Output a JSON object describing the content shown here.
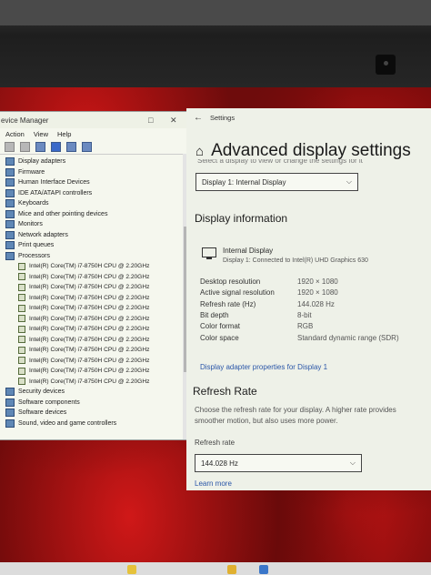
{
  "device_manager": {
    "title": "evice Manager",
    "menu": [
      "Action",
      "View",
      "Help"
    ],
    "tree": [
      {
        "label": "Display adapters",
        "type": "top"
      },
      {
        "label": "Firmware",
        "type": "top"
      },
      {
        "label": "Human Interface Devices",
        "type": "top"
      },
      {
        "label": "IDE ATA/ATAPI controllers",
        "type": "top"
      },
      {
        "label": "Keyboards",
        "type": "top"
      },
      {
        "label": "Mice and other pointing devices",
        "type": "top"
      },
      {
        "label": "Monitors",
        "type": "top"
      },
      {
        "label": "Network adapters",
        "type": "top"
      },
      {
        "label": "Print queues",
        "type": "top"
      },
      {
        "label": "Processors",
        "type": "top"
      },
      {
        "label": "Intel(R) Core(TM) i7-8750H CPU @ 2.20GHz",
        "type": "cpu"
      },
      {
        "label": "Intel(R) Core(TM) i7-8750H CPU @ 2.20GHz",
        "type": "cpu"
      },
      {
        "label": "Intel(R) Core(TM) i7-8750H CPU @ 2.20GHz",
        "type": "cpu"
      },
      {
        "label": "Intel(R) Core(TM) i7-8750H CPU @ 2.20GHz",
        "type": "cpu"
      },
      {
        "label": "Intel(R) Core(TM) i7-8750H CPU @ 2.20GHz",
        "type": "cpu"
      },
      {
        "label": "Intel(R) Core(TM) i7-8750H CPU @ 2.20GHz",
        "type": "cpu"
      },
      {
        "label": "Intel(R) Core(TM) i7-8750H CPU @ 2.20GHz",
        "type": "cpu"
      },
      {
        "label": "Intel(R) Core(TM) i7-8750H CPU @ 2.20GHz",
        "type": "cpu"
      },
      {
        "label": "Intel(R) Core(TM) i7-8750H CPU @ 2.20GHz",
        "type": "cpu"
      },
      {
        "label": "Intel(R) Core(TM) i7-8750H CPU @ 2.20GHz",
        "type": "cpu"
      },
      {
        "label": "Intel(R) Core(TM) i7-8750H CPU @ 2.20GHz",
        "type": "cpu"
      },
      {
        "label": "Intel(R) Core(TM) i7-8750H CPU @ 2.20GHz",
        "type": "cpu"
      },
      {
        "label": "Security devices",
        "type": "top"
      },
      {
        "label": "Software components",
        "type": "top"
      },
      {
        "label": "Software devices",
        "type": "top"
      },
      {
        "label": "Sound, video and game controllers",
        "type": "top"
      }
    ]
  },
  "settings": {
    "window_title": "Settings",
    "page_title": "Advanced display settings",
    "cut_text": "Select a display to view or change the settings for it",
    "display_select": "Display 1: Internal Display",
    "display_info_heading": "Display information",
    "display_name": "Internal Display",
    "display_sub": "Display 1: Connected to Intel(R) UHD Graphics 630",
    "info_rows": [
      {
        "key": "Desktop resolution",
        "value": "1920 × 1080"
      },
      {
        "key": "Active signal resolution",
        "value": "1920 × 1080"
      },
      {
        "key": "Refresh rate (Hz)",
        "value": "144.028 Hz"
      },
      {
        "key": "Bit depth",
        "value": "8-bit"
      },
      {
        "key": "Color format",
        "value": "RGB"
      },
      {
        "key": "Color space",
        "value": "Standard dynamic range (SDR)"
      }
    ],
    "adapter_link": "Display adapter properties for Display 1",
    "refresh_heading": "Refresh Rate",
    "refresh_desc": "Choose the refresh rate for your display. A higher rate provides smoother motion, but also uses more power.",
    "refresh_label": "Refresh rate",
    "refresh_select": "144.028 Hz",
    "learn_more": "Learn more"
  },
  "colors": {
    "accent_link": "#2a56a8",
    "wallpaper_red": "#c81515"
  }
}
